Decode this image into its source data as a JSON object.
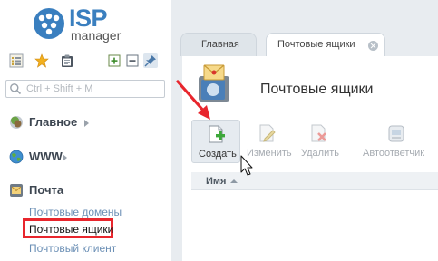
{
  "app": {
    "logo_text": "ISP",
    "logo_subtext": "manager"
  },
  "sidebar": {
    "toolbar_icons": [
      "list-icon",
      "star-icon",
      "clipboard-icon",
      "expand-icon",
      "collapse-icon",
      "pin-icon"
    ],
    "search": {
      "placeholder": "Ctrl + Shift + M",
      "value": ""
    },
    "sections": [
      {
        "label": "Главное",
        "icon": "home-icon",
        "expandable": true
      },
      {
        "label": "WWW",
        "icon": "globe-icon",
        "expandable": true
      },
      {
        "label": "Почта",
        "icon": "mail-icon",
        "expandable": false
      }
    ],
    "mail_items": [
      {
        "label": "Почтовые домены",
        "active": false
      },
      {
        "label": "Почтовые ящики",
        "active": true
      },
      {
        "label": "Почтовый клиент",
        "active": false
      }
    ]
  },
  "tabs": [
    {
      "label": "Главная",
      "active": false,
      "closable": false
    },
    {
      "label": "Почтовые ящики",
      "active": true,
      "closable": true
    }
  ],
  "page": {
    "title": "Почтовые ящики",
    "icon": "mailbox-icon"
  },
  "toolbar": {
    "buttons": [
      {
        "label": "Создать",
        "icon": "create-icon",
        "enabled": true
      },
      {
        "label": "Изменить",
        "icon": "edit-icon",
        "enabled": false
      },
      {
        "label": "Удалить",
        "icon": "delete-icon",
        "enabled": false
      },
      {
        "label": "Автоответчик",
        "icon": "autoresponder-icon",
        "enabled": false
      }
    ]
  },
  "grid": {
    "columns": [
      {
        "label": "Имя",
        "sort": "ascending"
      }
    ]
  },
  "colors": {
    "brand": "#3a7fbf",
    "highlight": "#e8262d",
    "arrow": "#e8262d",
    "link": "#6b8fb5"
  }
}
